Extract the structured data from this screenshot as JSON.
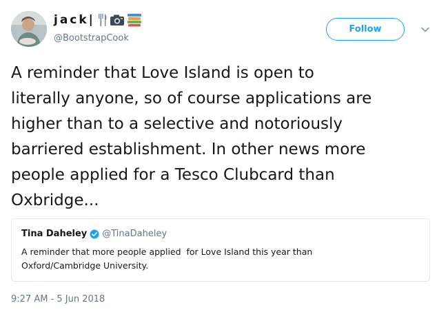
{
  "author": {
    "display_name": "jack|",
    "handle": "@BootstrapCook",
    "name_icons": [
      "fork-and-knife-icon",
      "camera-icon",
      "books-icon"
    ]
  },
  "actions": {
    "follow_label": "Follow",
    "menu_icon": "chevron-down-icon"
  },
  "tweet": {
    "text_lines": [
      "A reminder that Love Island is open to",
      "literally anyone, so of course applications are",
      "higher than to a selective and notoriously",
      "barriered establishment. In other news more",
      "people applied for a Tesco Clubcard than",
      "Oxbridge..."
    ],
    "timestamp": "9:27 AM - 5 Jun 2018"
  },
  "quoted_tweet": {
    "display_name": "Tina Daheley",
    "verified": true,
    "handle": "@TinaDaheley",
    "text_lines": [
      "A reminder that more people applied  for Love Island this year than",
      "Oxford/Cambridge University."
    ]
  },
  "colors": {
    "accent": "#1da1f2",
    "text": "#14171a",
    "secondary": "#657786",
    "border": "#e1e8ed"
  }
}
